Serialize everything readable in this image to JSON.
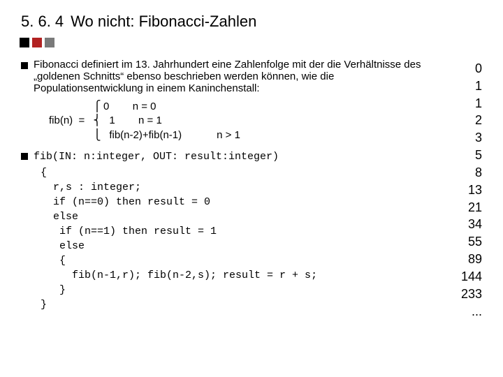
{
  "header": {
    "section_number": "5. 6. 4",
    "title": "Wo nicht: Fibonacci-Zahlen"
  },
  "bullets": {
    "intro": "Fibonacci definiert im 13. Jahrhundert eine Zahlenfolge mit der die Verhältnisse des „goldenen Schnitts“ ebenso beschrieben werden können, wie die Populationsentwicklung in einem Kaninchenstall:"
  },
  "formula": {
    "label": "fib(n)",
    "eq": "=",
    "brace_top": "⎧",
    "brace_mid": "⎨",
    "brace_bot": "⎩",
    "line1_left": "0",
    "line1_right": "n = 0",
    "line2_left": "1",
    "line2_right": "n = 1",
    "line3_left": "fib(n-2)+fib(n-1)",
    "line3_right": "n > 1"
  },
  "code": {
    "sig": "fib(IN: n:integer, OUT: result:integer)",
    "l1": "{",
    "l2": "  r,s : integer;",
    "l3": "  if (n==0) then result = 0",
    "l4": "  else",
    "l5": "   if (n==1) then result = 1",
    "l6": "   else",
    "l7": "   {",
    "l8": "     fib(n-1,r); fib(n-2,s); result = r + s;",
    "l9": "   }",
    "l10": "}"
  },
  "sequence": [
    "0",
    "1",
    "1",
    "2",
    "3",
    "5",
    "8",
    "13",
    "21",
    "34",
    "55",
    "89",
    "144",
    "233",
    "..."
  ]
}
